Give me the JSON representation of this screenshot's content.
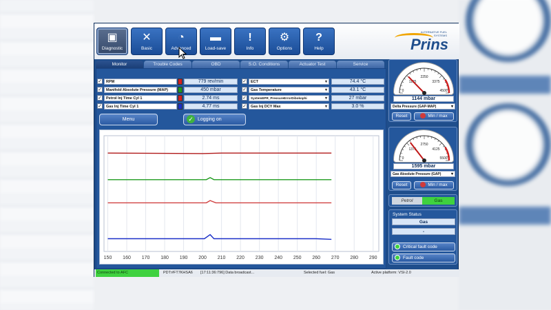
{
  "toolbar": {
    "buttons": [
      {
        "label": "Diagnostic",
        "icon": "monitor-icon"
      },
      {
        "label": "Basic",
        "icon": "tools-icon"
      },
      {
        "label": "Advanced",
        "icon": "gauge-wrench-icon"
      },
      {
        "label": "Load-save",
        "icon": "car-load-icon"
      },
      {
        "label": "Info",
        "icon": "info-icon"
      },
      {
        "label": "Options",
        "icon": "gear-icon"
      },
      {
        "label": "Help",
        "icon": "help-icon"
      }
    ],
    "brand": "Prins",
    "brand_sub": "ALTERNATIVE FUEL SYSTEMS"
  },
  "tabs": [
    "Monitor",
    "Trouble Codes",
    "OBD",
    "S.O. Conditions",
    "Actuator Test",
    "Service"
  ],
  "params_left": [
    {
      "label": "RPM",
      "value": "779 rev/min",
      "color": "#d42020"
    },
    {
      "label": "Manifold Absolute Pressure (MAP)",
      "value": "450 mbar",
      "color": "#1c9a1c"
    },
    {
      "label": "Petrol Inj Time Cyl 1",
      "value": "2.74 ms",
      "color": "#d42020"
    },
    {
      "label": "Gas Inj Time Cyl 1",
      "value": "4.77 ms",
      "color": "#1a2fc8"
    }
  ],
  "params_right": [
    {
      "label": "ECT",
      "value": "74.4 °C"
    },
    {
      "label": "Gas Temperature",
      "value": "43.1 °C"
    },
    {
      "label": "SystemEPR_PressureErrorDibokophi",
      "value": "27 mbar"
    },
    {
      "label": "Gas Inj DCY Max",
      "value": "3.0 %"
    }
  ],
  "menu_label": "Menu",
  "logging_label": "Logging on",
  "chart_data": {
    "type": "line",
    "x_ticks": [
      150,
      160,
      170,
      180,
      190,
      200,
      210,
      220,
      230,
      240,
      250,
      260,
      270,
      280,
      290
    ],
    "xlim": [
      148,
      293
    ],
    "ylim": [
      0,
      100
    ],
    "series": [
      {
        "color": "#b01818",
        "points": [
          [
            150,
            85
          ],
          [
            200,
            84.6
          ],
          [
            210,
            85
          ],
          [
            268,
            85
          ]
        ]
      },
      {
        "color": "#1c9a1c",
        "points": [
          [
            150,
            62
          ],
          [
            202,
            62
          ],
          [
            204,
            63.8
          ],
          [
            206,
            62
          ],
          [
            268,
            62
          ]
        ]
      },
      {
        "color": "#d04040",
        "points": [
          [
            150,
            42
          ],
          [
            202,
            42
          ],
          [
            204,
            44
          ],
          [
            207,
            42
          ],
          [
            268,
            42
          ]
        ]
      },
      {
        "color": "#1a2fc8",
        "points": [
          [
            150,
            11
          ],
          [
            201,
            11
          ],
          [
            204,
            14.5
          ],
          [
            206,
            11
          ],
          [
            260,
            11
          ],
          [
            268,
            10.5
          ]
        ]
      }
    ]
  },
  "gauge1": {
    "reading": "1144 mbar",
    "select": "Delta Pressure (GAP-MAP)",
    "ticks": [
      "2250",
      "1125",
      "3375",
      "0",
      "4500"
    ],
    "value": 1144,
    "max": 4500
  },
  "gauge2": {
    "reading": "1595 mbar",
    "select": "Gas Absolute Pressure (GAP)",
    "ticks": [
      "2750",
      "1375",
      "4125",
      "0",
      "5500"
    ],
    "value": 1595,
    "max": 5500
  },
  "reset_label": "Reset",
  "minmax_label": "Min / max",
  "fuel": {
    "petrol": "Petrol",
    "gas": "Gas"
  },
  "system_status": {
    "title": "System Status",
    "value": "Gas",
    "value2": "-"
  },
  "faults": {
    "critical": "Critical fault code",
    "fault": "Fault code"
  },
  "statusbar": {
    "connection": "Connected to AFC",
    "pdt": "PDT:#FT7KHSA6",
    "log": "[17:11:36:796] Data broadcast...",
    "fuel": "Selected fuel: Gas",
    "platform": "Active platform: VSI-2.0"
  }
}
